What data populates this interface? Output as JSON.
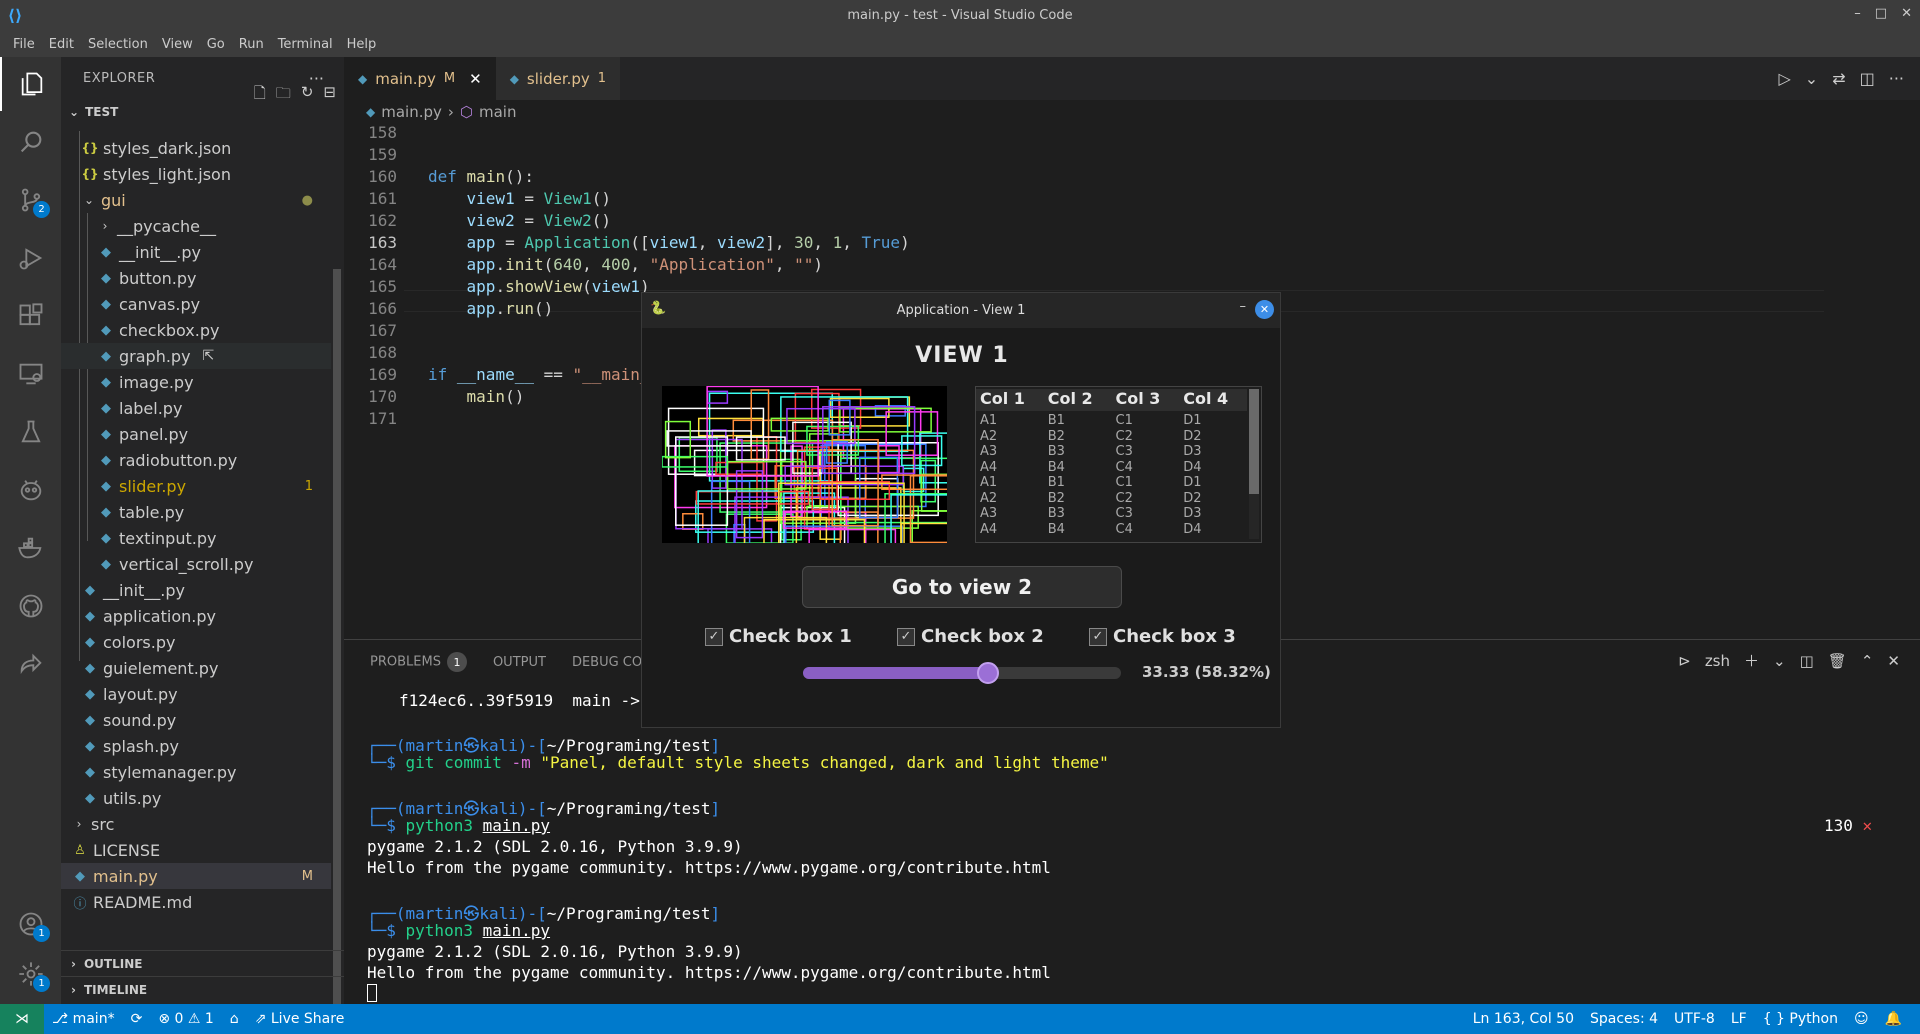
{
  "window": {
    "title": "main.py - test - Visual Studio Code"
  },
  "menu": [
    "File",
    "Edit",
    "Selection",
    "View",
    "Go",
    "Run",
    "Terminal",
    "Help"
  ],
  "activity": {
    "scm_badge": "2",
    "accounts_badge": "1",
    "settings_badge": "1"
  },
  "explorer": {
    "header": "EXPLORER",
    "section": "TEST",
    "items": [
      {
        "label": "styles_dark.json"
      },
      {
        "label": "styles_light.json"
      },
      {
        "label": "gui"
      },
      {
        "label": "__pycache__"
      },
      {
        "label": "__init__.py"
      },
      {
        "label": "button.py"
      },
      {
        "label": "canvas.py"
      },
      {
        "label": "checkbox.py"
      },
      {
        "label": "graph.py"
      },
      {
        "label": "image.py"
      },
      {
        "label": "label.py"
      },
      {
        "label": "panel.py"
      },
      {
        "label": "radiobutton.py"
      },
      {
        "label": "slider.py",
        "decoration": "1"
      },
      {
        "label": "table.py"
      },
      {
        "label": "textinput.py"
      },
      {
        "label": "vertical_scroll.py"
      },
      {
        "label": "__init__.py"
      },
      {
        "label": "application.py"
      },
      {
        "label": "colors.py"
      },
      {
        "label": "guielement.py"
      },
      {
        "label": "layout.py"
      },
      {
        "label": "sound.py"
      },
      {
        "label": "splash.py"
      },
      {
        "label": "stylemanager.py"
      },
      {
        "label": "utils.py"
      },
      {
        "label": "src"
      },
      {
        "label": "LICENSE"
      },
      {
        "label": "main.py",
        "decoration": "M"
      },
      {
        "label": "README.md"
      }
    ],
    "outline": "OUTLINE",
    "timeline": "TIMELINE"
  },
  "tabs": [
    {
      "label": "main.py",
      "badge": "M"
    },
    {
      "label": "slider.py",
      "badge": "1"
    }
  ],
  "breadcrumb": {
    "file": "main.py",
    "symbol": "main"
  },
  "code": {
    "line_numbers": [
      "158",
      "159",
      "160",
      "161",
      "162",
      "163",
      "164",
      "165",
      "166",
      "167",
      "168",
      "169",
      "170",
      "171"
    ]
  },
  "panel": {
    "tabs": [
      "PROBLEMS",
      "OUTPUT",
      "DEBUG CO"
    ],
    "problems_count": "1",
    "shell": "zsh",
    "lines": {
      "l0": "f124ec6..39f5919  main -> main",
      "user": "martin",
      "host": "kali",
      "path": "~/Programing/test",
      "cmd1": "git commit",
      "cmd1_flag": "-m",
      "cmd1_msg": "\"Panel, default style sheets changed, dark and light theme\"",
      "cmd2": "python3",
      "cmd2_arg": "main.py",
      "out1": "pygame 2.1.2 (SDL 2.0.16, Python 3.9.9)",
      "out2": "Hello from the pygame community. https://www.pygame.org/contribute.html",
      "exit_code": "130"
    }
  },
  "status": {
    "branch": "main*",
    "errors": "0",
    "warnings": "1",
    "liveshare": "Live Share",
    "position": "Ln 163, Col 50",
    "spaces": "Spaces: 4",
    "encoding": "UTF-8",
    "eol": "LF",
    "language": "Python"
  },
  "app": {
    "title": "Application - View 1",
    "view_title": "VIEW 1",
    "table": {
      "columns": [
        "Col 1",
        "Col 2",
        "Col 3",
        "Col 4"
      ],
      "rows": [
        [
          "A1",
          "B1",
          "C1",
          "D1"
        ],
        [
          "A2",
          "B2",
          "C2",
          "D2"
        ],
        [
          "A3",
          "B3",
          "C3",
          "D3"
        ],
        [
          "A4",
          "B4",
          "C4",
          "D4"
        ],
        [
          "A1",
          "B1",
          "C1",
          "D1"
        ],
        [
          "A2",
          "B2",
          "C2",
          "D2"
        ],
        [
          "A3",
          "B3",
          "C3",
          "D3"
        ],
        [
          "A4",
          "B4",
          "C4",
          "D4"
        ]
      ]
    },
    "button": "Go to view 2",
    "checkboxes": [
      "Check box 1",
      "Check box 2",
      "Check box 3"
    ],
    "slider": {
      "value_label": "33.33 (58.32%)",
      "fraction": 0.5832
    }
  }
}
